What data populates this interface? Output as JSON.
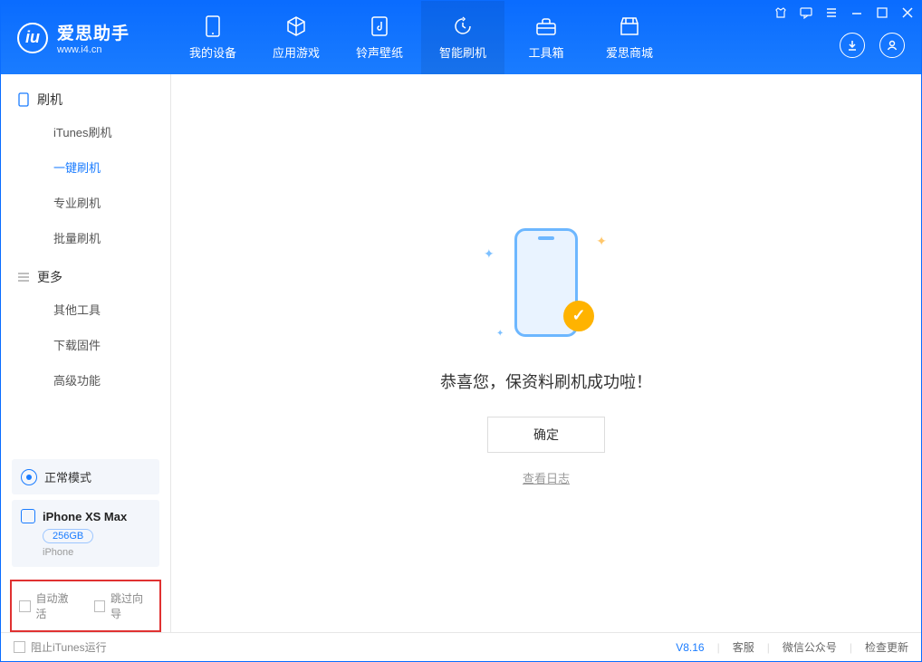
{
  "app": {
    "name": "爱思助手",
    "domain": "www.i4.cn"
  },
  "nav": [
    {
      "label": "我的设备",
      "icon": "device"
    },
    {
      "label": "应用游戏",
      "icon": "cube"
    },
    {
      "label": "铃声壁纸",
      "icon": "music"
    },
    {
      "label": "智能刷机",
      "icon": "refresh",
      "active": true
    },
    {
      "label": "工具箱",
      "icon": "toolbox"
    },
    {
      "label": "爱思商城",
      "icon": "store"
    }
  ],
  "sidebar": {
    "sections": [
      {
        "title": "刷机",
        "icon": "phone",
        "items": [
          {
            "label": "iTunes刷机"
          },
          {
            "label": "一键刷机",
            "active": true
          },
          {
            "label": "专业刷机"
          },
          {
            "label": "批量刷机"
          }
        ]
      },
      {
        "title": "更多",
        "icon": "menu",
        "items": [
          {
            "label": "其他工具"
          },
          {
            "label": "下载固件"
          },
          {
            "label": "高级功能"
          }
        ]
      }
    ],
    "status": "正常模式",
    "device": {
      "name": "iPhone XS Max",
      "storage": "256GB",
      "type": "iPhone"
    },
    "checks": {
      "auto_activate": "自动激活",
      "skip_guide": "跳过向导"
    }
  },
  "main": {
    "success_message": "恭喜您，保资料刷机成功啦！",
    "ok_label": "确定",
    "log_link": "查看日志"
  },
  "footer": {
    "block_itunes": "阻止iTunes运行",
    "version": "V8.16",
    "links": {
      "service": "客服",
      "wechat": "微信公众号",
      "update": "检查更新"
    }
  }
}
